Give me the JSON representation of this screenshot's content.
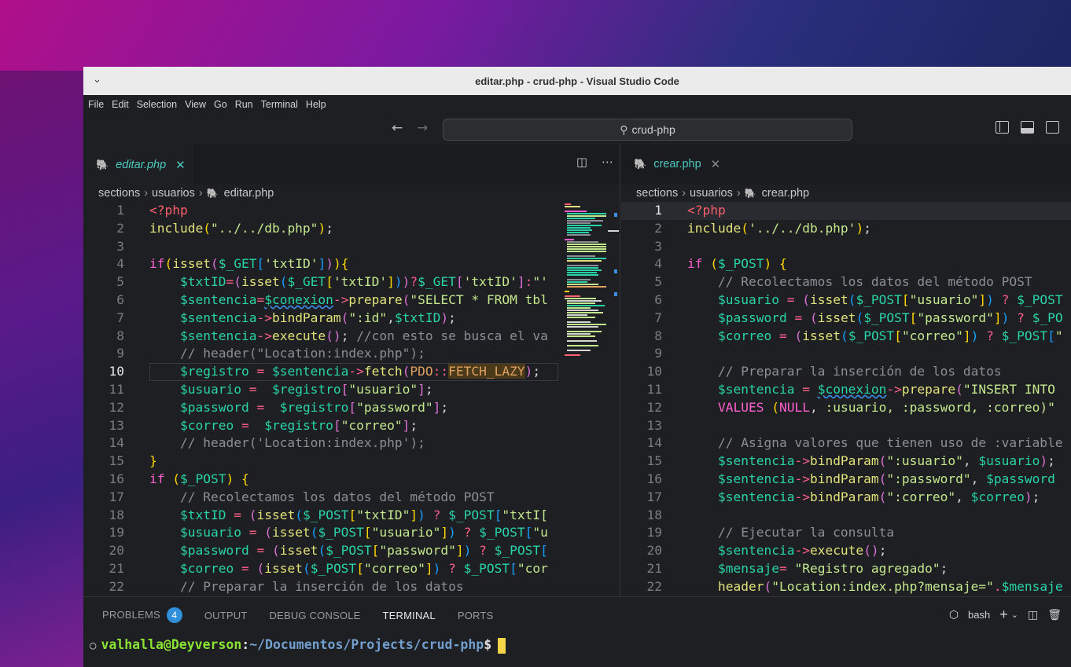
{
  "window": {
    "title": "editar.php - crud-php - Visual Studio Code"
  },
  "menu": [
    "File",
    "Edit",
    "Selection",
    "View",
    "Go",
    "Run",
    "Terminal",
    "Help"
  ],
  "search": {
    "text": "crud-php"
  },
  "left": {
    "tab": "editar.php",
    "breadcrumb": [
      "sections",
      "usuarios",
      "editar.php"
    ],
    "current_line": 10
  },
  "right": {
    "tab": "crear.php",
    "breadcrumb": [
      "sections",
      "usuarios",
      "crear.php"
    ],
    "current_line": 1
  },
  "panel": {
    "tabs": [
      "PROBLEMS",
      "OUTPUT",
      "DEBUG CONSOLE",
      "TERMINAL",
      "PORTS"
    ],
    "problems_count": "4",
    "active_tab": "TERMINAL",
    "shell": "bash"
  },
  "terminal": {
    "user": "valhalla@Deyverson",
    "sep": ":",
    "path": "~/Documentos/Projects/crud-php",
    "prompt": "$"
  },
  "colors": {
    "accent": "#2f8fd8",
    "teal": "#4ec9c0",
    "cursor": "#f5d547"
  }
}
